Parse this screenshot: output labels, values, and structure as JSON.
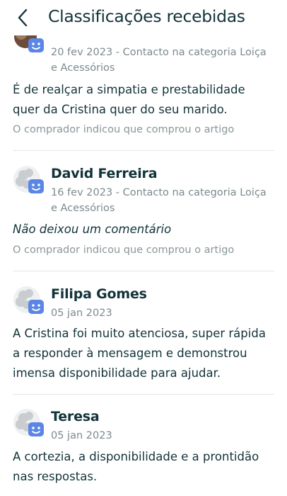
{
  "header": {
    "title": "Classificações recebidas",
    "back_icon": "chevron-left-icon"
  },
  "colors": {
    "text": "#12333a",
    "muted": "#7b8a8e",
    "badge": "#5b86e5",
    "divider": "#e3e6e7"
  },
  "reviews": [
    {
      "name": "",
      "meta": "20 fev 2023 - Contacto na categoria Loiça e Acessórios",
      "comment": "É de realçar a simpatia e prestabilidade quer da Cristina quer do seu marido.",
      "note": "O comprador indicou que comprou o artigo"
    },
    {
      "name": "David Ferreira",
      "meta": "16 fev 2023 - Contacto na categoria Loiça e Acessórios",
      "comment": "Não deixou um comentário",
      "note": "O comprador indicou que comprou o artigo"
    },
    {
      "name": "Filipa Gomes",
      "meta": "05 jan 2023",
      "comment": "A Cristina foi muito atenciosa, super rápida a responder à mensagem e demonstrou imensa disponibilidade para ajudar."
    },
    {
      "name": "Teresa",
      "meta": "05 jan 2023",
      "comment": "A cortezia, a disponibilidade e a prontidão nas respostas."
    }
  ]
}
